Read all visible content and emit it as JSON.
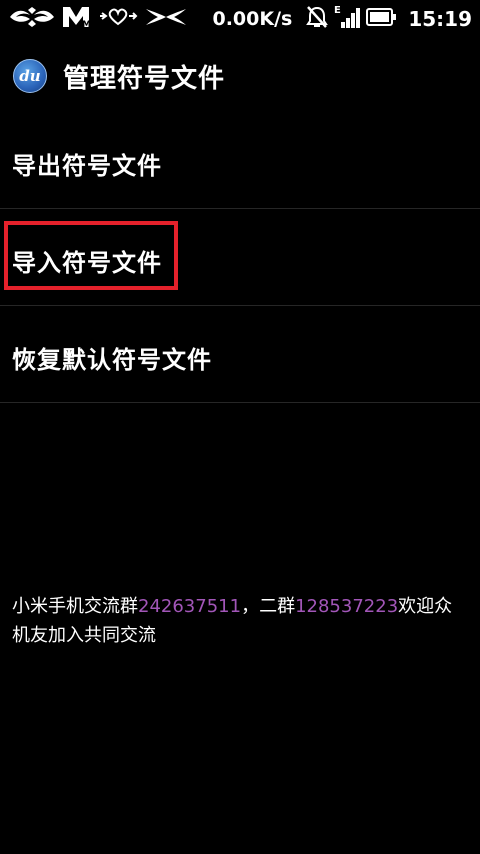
{
  "status_bar": {
    "carrier_logo_text": "MTV",
    "net_speed": "0.00K/s",
    "network_type": "E",
    "time": "15:19",
    "icons": [
      "tribal-ornament-icon",
      "mtv-logo-icon",
      "hearts-icon",
      "tribal-ornament-icon",
      "alarm-off-icon",
      "signal-icon",
      "battery-icon"
    ]
  },
  "header": {
    "app_logo_text": "du",
    "title": "管理符号文件"
  },
  "menu": {
    "items": [
      {
        "label": "导出符号文件"
      },
      {
        "label": "导入符号文件",
        "highlighted": true
      },
      {
        "label": "恢复默认符号文件"
      }
    ]
  },
  "footer": {
    "part1": "小米手机交流群",
    "group1": "242637511",
    "part2": "，二群",
    "group2": "128537223",
    "part3": "欢迎众机友加入共同交流"
  },
  "colors": {
    "background": "#000000",
    "text": "#ffffff",
    "accent_number": "#a256b8",
    "highlight_border": "#e5212b",
    "divider": "#262626"
  }
}
